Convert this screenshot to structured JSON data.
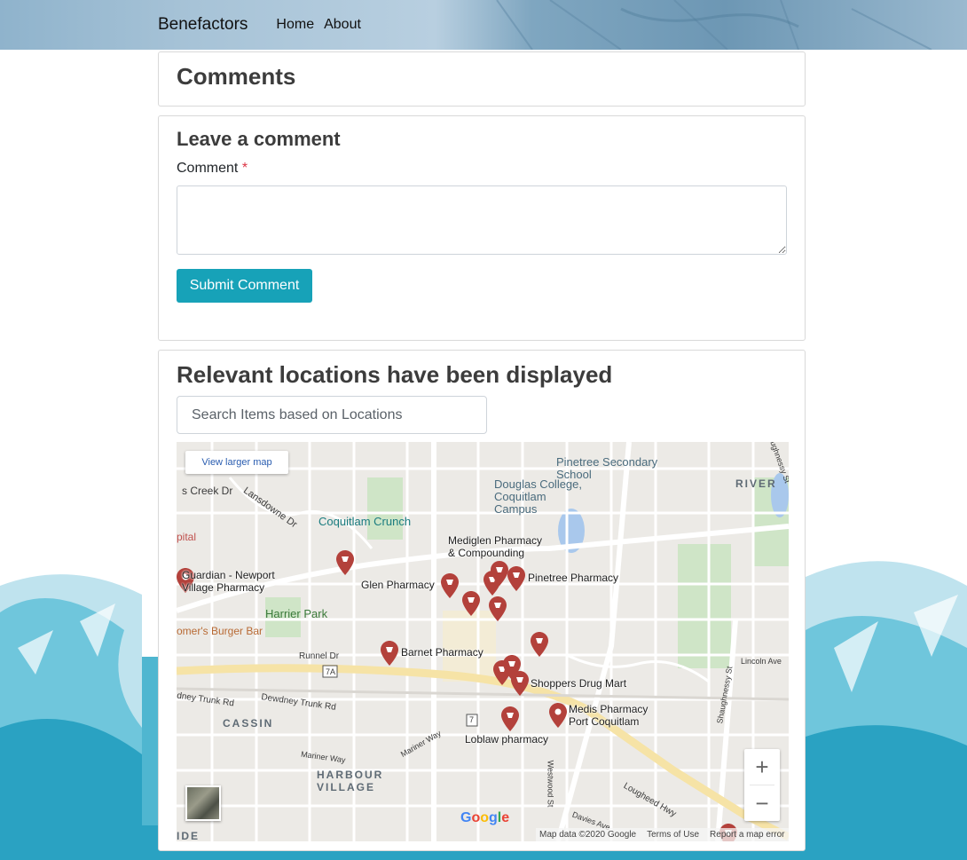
{
  "navbar": {
    "brand": "Benefactors",
    "links": [
      "Home",
      "About"
    ]
  },
  "comments": {
    "title": "Comments"
  },
  "leave_comment": {
    "title": "Leave a comment",
    "label": "Comment",
    "required_mark": "*",
    "textarea_value": "",
    "submit_label": "Submit Comment"
  },
  "locations": {
    "title": "Relevant locations have been displayed",
    "search_placeholder": "Search Items based on Locations",
    "search_value": ""
  },
  "map": {
    "view_larger": "View larger map",
    "zoom_in": "+",
    "zoom_out": "−",
    "attribution": [
      "Map data ©2020 Google",
      "Terms of Use",
      "Report a map error"
    ],
    "google_logo": "Google",
    "places": {
      "pinetree_school": "Pinetree Secondary School",
      "douglas_college": "Douglas College, Coquitlam Campus",
      "coquitlam_crunch": "Coquitlam Crunch",
      "river": "RIVER",
      "creek_dr": "s Creek Dr",
      "lansdowne": "Lansdowne Dr",
      "hospital": "pital",
      "harrier_park": "Harrier Park",
      "burger_bar": "omer's Burger Bar",
      "runnel_dr": "Runnel Dr",
      "dewdney_rd": "Dewdney Trunk Rd",
      "dewdney_rd2": "dney Trunk Rd",
      "cassin": "CASSIN",
      "harbour_village": "HARBOUR VILLAGE",
      "mariner_way": "Mariner Way",
      "mariner_way2": "Mariner Way",
      "lougheed": "Lougheed Hwy",
      "westwood": "Westwood St",
      "davies": "Davies Ave",
      "lincoln": "Lincoln Ave",
      "shaughnessy": "Shaughnessy St",
      "shaughnessy2": "Shaughnessy St",
      "ide": "IDE",
      "hwy7a": "7A",
      "hwy7": "7"
    },
    "pins": [
      {
        "label": "Mediglen Pharmacy & Compounding"
      },
      {
        "label": "Pinetree Pharmacy"
      },
      {
        "label": "Glen Pharmacy"
      },
      {
        "label": "Guardian - Newport Village Pharmacy"
      },
      {
        "label": "Barnet Pharmacy"
      },
      {
        "label": "Shoppers Drug Mart"
      },
      {
        "label": "Medis Pharmacy Port Coquitlam"
      },
      {
        "label": "Loblaw pharmacy"
      }
    ]
  },
  "colors": {
    "accent": "#17a2b8",
    "pin": "#b3413b",
    "required": "#dc3545"
  }
}
